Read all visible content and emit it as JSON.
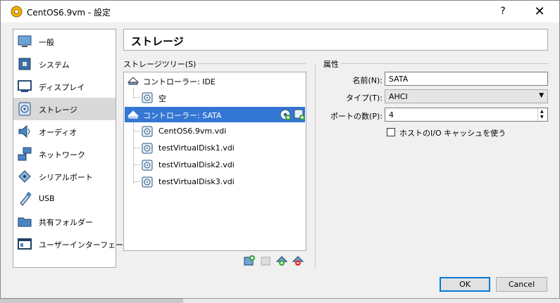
{
  "window": {
    "title": "CentOS6.9vm - 設定",
    "help_label": "?",
    "close_label": "✕"
  },
  "sidebar": {
    "items": [
      {
        "label": "一般",
        "icon": "general-icon"
      },
      {
        "label": "システム",
        "icon": "system-icon"
      },
      {
        "label": "ディスプレイ",
        "icon": "display-icon"
      },
      {
        "label": "ストレージ",
        "icon": "storage-icon",
        "selected": true
      },
      {
        "label": "オーディオ",
        "icon": "audio-icon"
      },
      {
        "label": "ネットワーク",
        "icon": "network-icon"
      },
      {
        "label": "シリアルポート",
        "icon": "serial-port-icon"
      },
      {
        "label": "USB",
        "icon": "usb-icon"
      },
      {
        "label": "共有フォルダー",
        "icon": "shared-folder-icon"
      },
      {
        "label": "ユーザーインターフェース",
        "icon": "user-interface-icon"
      }
    ]
  },
  "page": {
    "title": "ストレージ"
  },
  "storage_tree": {
    "group_label": "ストレージツリー(S)",
    "controllers": [
      {
        "label": "コントローラー: IDE",
        "selected": false,
        "devices": [
          {
            "label": "空",
            "type": "optical"
          }
        ]
      },
      {
        "label": "コントローラー: SATA",
        "selected": true,
        "devices": [
          {
            "label": "CentOS6.9vm.vdi",
            "type": "disk"
          },
          {
            "label": "testVirtualDisk1.vdi",
            "type": "disk"
          },
          {
            "label": "testVirtualDisk2.vdi",
            "type": "disk"
          },
          {
            "label": "testVirtualDisk3.vdi",
            "type": "disk"
          }
        ]
      }
    ]
  },
  "attributes": {
    "group_label": "属性",
    "name_label": "名前(N):",
    "name_value": "SATA",
    "type_label": "タイプ(T):",
    "type_value": "AHCI",
    "port_label": "ポートの数(P):",
    "port_value": "4",
    "host_cache_label": "ホストのI/O キャッシュを使う",
    "host_cache_checked": false
  },
  "buttons": {
    "ok": "OK",
    "cancel": "Cancel"
  },
  "colors": {
    "selection": "#3476d3",
    "sidebar_selection": "#d9d9d9",
    "default_button_border": "#0078d7"
  }
}
